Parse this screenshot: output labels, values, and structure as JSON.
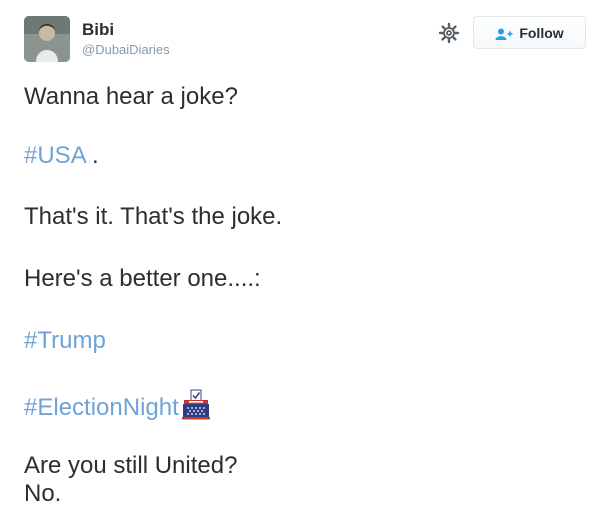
{
  "user": {
    "name": "Bibi",
    "handle": "@DubaiDiaries"
  },
  "actions": {
    "follow_label": "Follow",
    "settings_icon": "gear-icon",
    "follow_icon": "add-user-icon"
  },
  "tweet": {
    "line1": "Wanna hear a joke?",
    "tag_usa": "#USA",
    "usa_suffix": " .",
    "line3": "That's it. That's the joke.",
    "line4": "Here's a better one....:",
    "tag_trump": "#Trump",
    "tag_electionnight": "#ElectionNight",
    "hashflag_icon": "ballot-box-icon",
    "line7": "Are you still United?",
    "line8": "No."
  },
  "colors": {
    "hashtag": "#6fa3d8",
    "text": "#292f33",
    "handle": "#8899a6"
  }
}
